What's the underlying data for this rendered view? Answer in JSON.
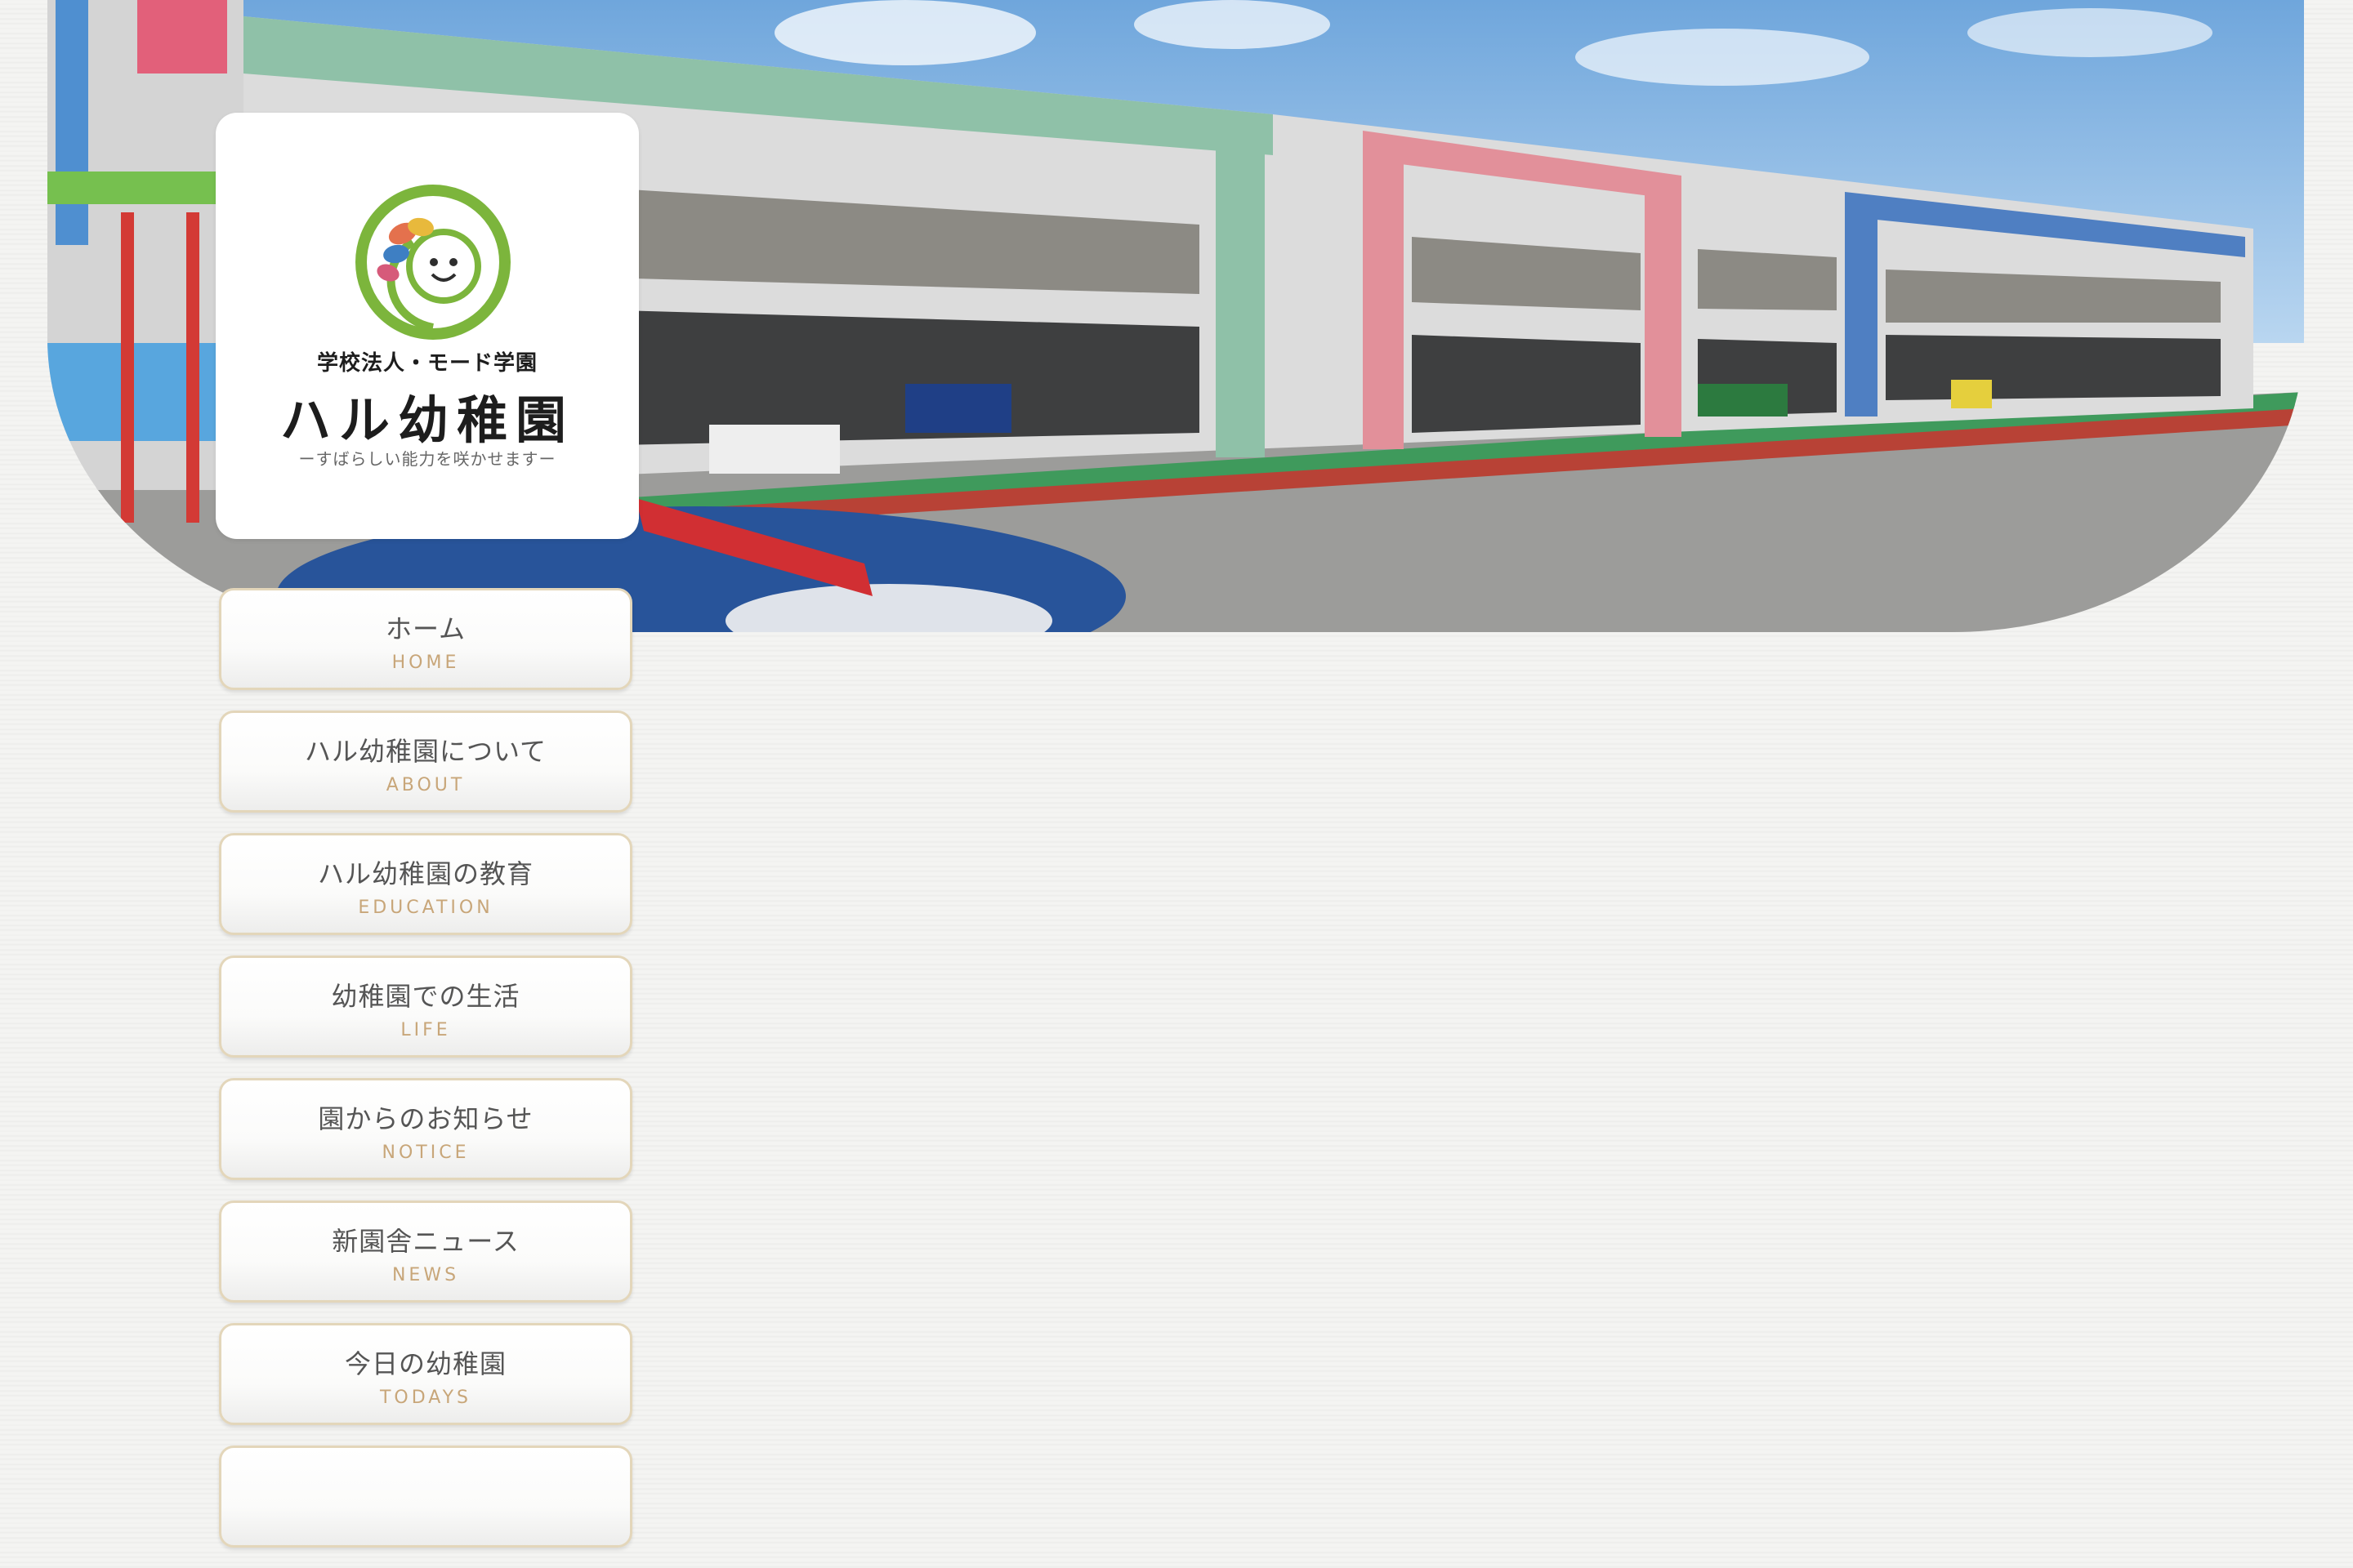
{
  "logo": {
    "org": "学校法人・モード学園",
    "name": "ハル幼稚園",
    "tagline": "ーすばらしい能力を咲かせますー"
  },
  "nav": {
    "items": [
      {
        "jp": "ホーム",
        "en": "HOME"
      },
      {
        "jp": "ハル幼稚園について",
        "en": "ABOUT"
      },
      {
        "jp": "ハル幼稚園の教育",
        "en": "EDUCATION"
      },
      {
        "jp": "幼稚園での生活",
        "en": "LIFE"
      },
      {
        "jp": "園からのお知らせ",
        "en": "NOTICE"
      },
      {
        "jp": "新園舎ニュース",
        "en": "NEWS"
      },
      {
        "jp": "今日の幼稚園",
        "en": "TODAYS"
      }
    ]
  },
  "colors": {
    "nav_border": "#e3d6ba",
    "nav_text": "#555555",
    "nav_subtext": "#c8a679",
    "logo_green": "#7cb53c"
  }
}
